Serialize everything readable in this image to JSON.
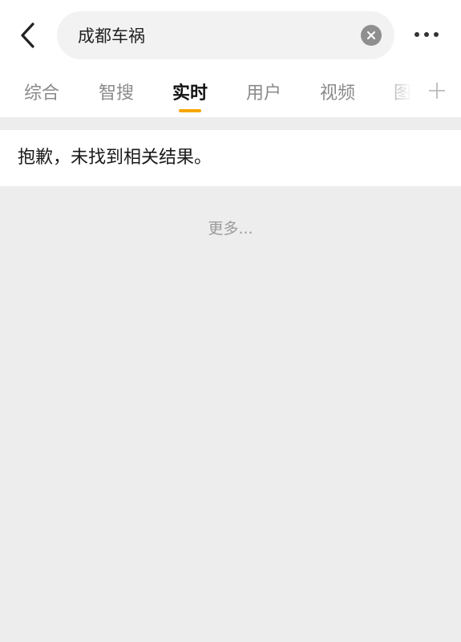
{
  "search": {
    "value": "成都车祸",
    "placeholder": ""
  },
  "tabs": [
    {
      "label": "综合",
      "active": false
    },
    {
      "label": "智搜",
      "active": false
    },
    {
      "label": "实时",
      "active": true
    },
    {
      "label": "用户",
      "active": false
    },
    {
      "label": "视频",
      "active": false
    },
    {
      "label": "图",
      "active": false
    }
  ],
  "icons": {
    "back": "chevron-left-icon",
    "clear": "clear-icon",
    "more": "more-dots-icon",
    "add_tab": "plus-icon"
  },
  "result": {
    "message": "抱歉，未找到相关结果。"
  },
  "more_link": "更多...",
  "colors": {
    "accent": "#f7a600",
    "background": "#ededed",
    "header_bg": "#ffffff",
    "search_bg": "#f2f2f2"
  }
}
